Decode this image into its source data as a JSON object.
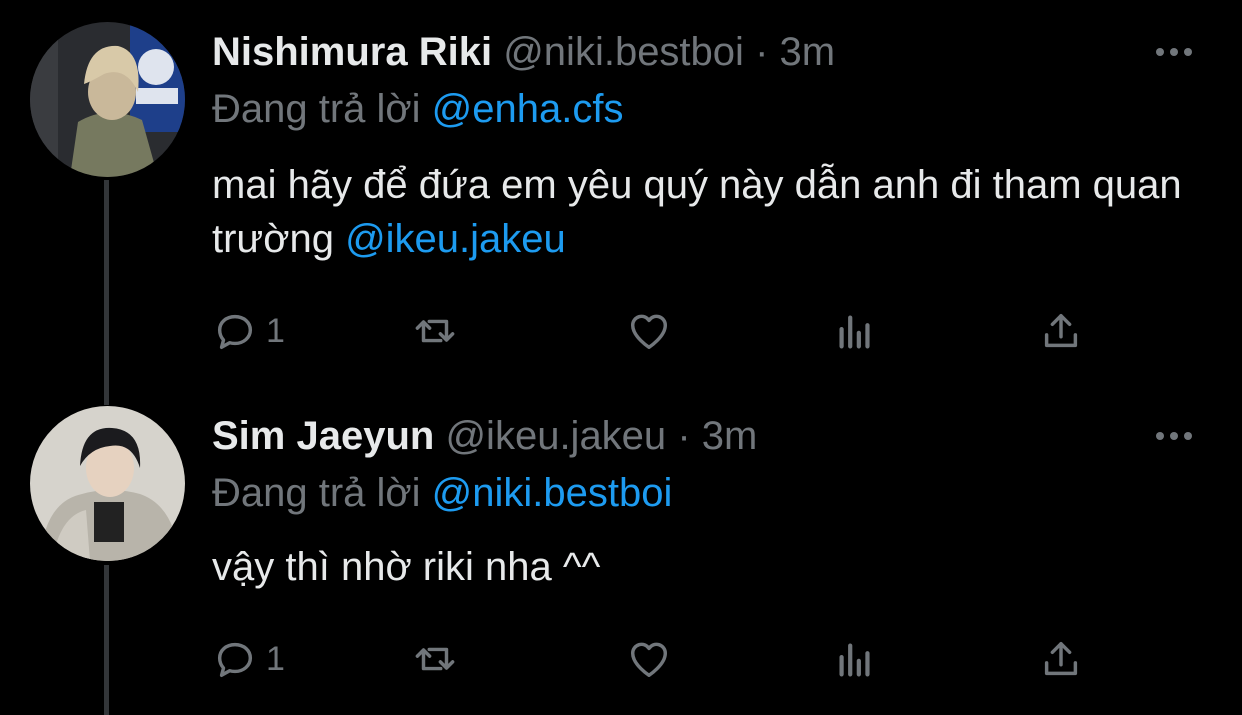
{
  "tweets": [
    {
      "name": "Nishimura Riki",
      "handle": "@niki.bestboi",
      "separator": "·",
      "time": "3m",
      "replying_label": "Đang trả lời",
      "replying_to": "@enha.cfs",
      "text_plain": "mai hãy để đứa em yêu quý này dẫn anh đi tham quan trường",
      "text_mention": "@ikeu.jakeu",
      "reply_count": "1"
    },
    {
      "name": "Sim Jaeyun",
      "handle": "@ikeu.jakeu",
      "separator": "·",
      "time": "3m",
      "replying_label": "Đang trả lời",
      "replying_to": "@niki.bestboi",
      "text_plain": "vậy thì nhờ riki nha ^^",
      "text_mention": "",
      "reply_count": "1"
    }
  ],
  "icons": {
    "reply": "reply-icon",
    "retweet": "retweet-icon",
    "like": "like-icon",
    "analytics": "analytics-icon",
    "share": "share-icon",
    "more": "more-icon"
  },
  "colors": {
    "background": "#000000",
    "text": "#e7e9ea",
    "muted": "#71767b",
    "link": "#1d9bf0",
    "thread_line": "#333639"
  }
}
